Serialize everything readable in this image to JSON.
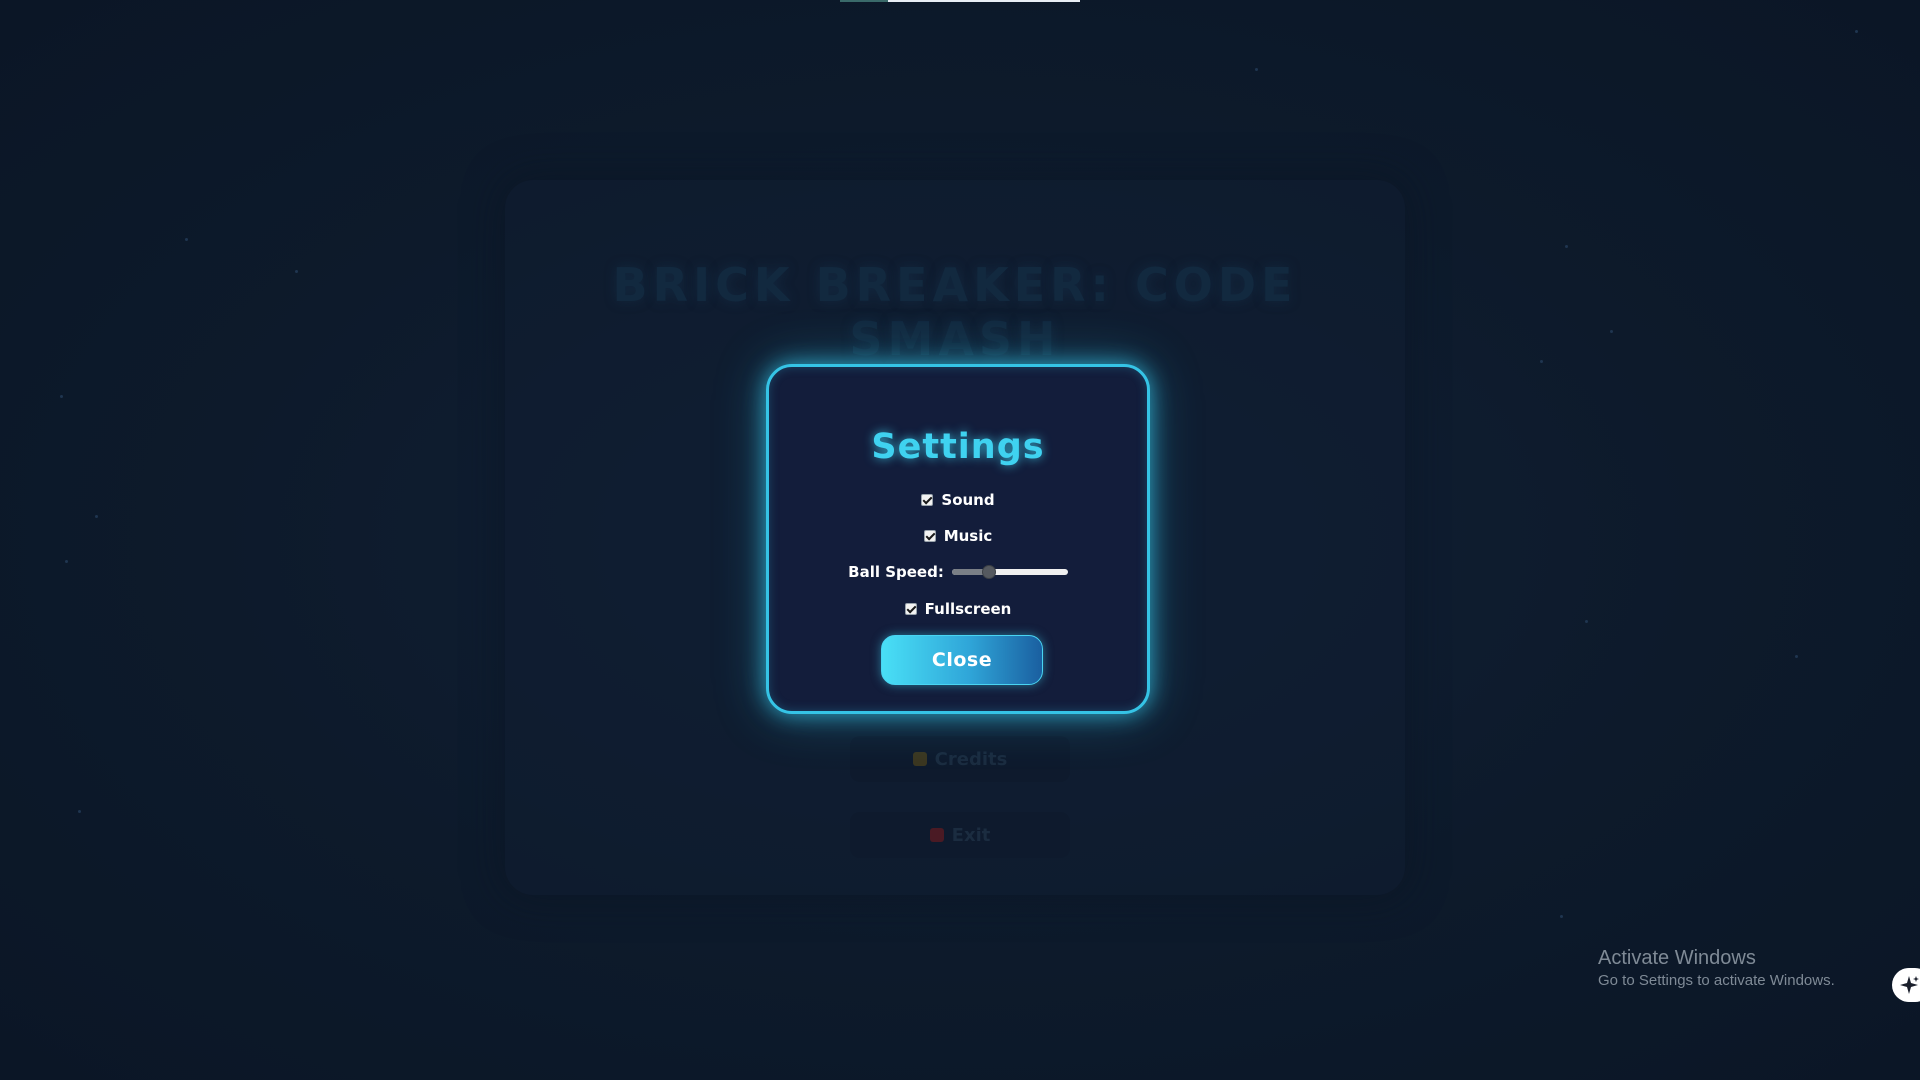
{
  "background_menu": {
    "title": "BRICK BREAKER: CODE SMASH",
    "buttons": [
      {
        "label": "Credits",
        "icon": "gear-icon",
        "accent": "#3b3620"
      },
      {
        "label": "Exit",
        "icon": "exit-door-icon",
        "accent": "#4a1a24"
      }
    ]
  },
  "settings_modal": {
    "title": "Settings",
    "sound_label": "Sound",
    "sound_checked": true,
    "music_label": "Music",
    "music_checked": true,
    "ball_speed_label": "Ball Speed:",
    "ball_speed_fraction": 0.3,
    "fullscreen_label": "Fullscreen",
    "fullscreen_checked": true,
    "close_label": "Close"
  },
  "windows_watermark": {
    "title": "Activate Windows",
    "subtitle": "Go to Settings to activate Windows."
  },
  "colors": {
    "accent": "#35c4e6",
    "modal_background": "#131d3b",
    "page_background": "#0d1a2b"
  }
}
